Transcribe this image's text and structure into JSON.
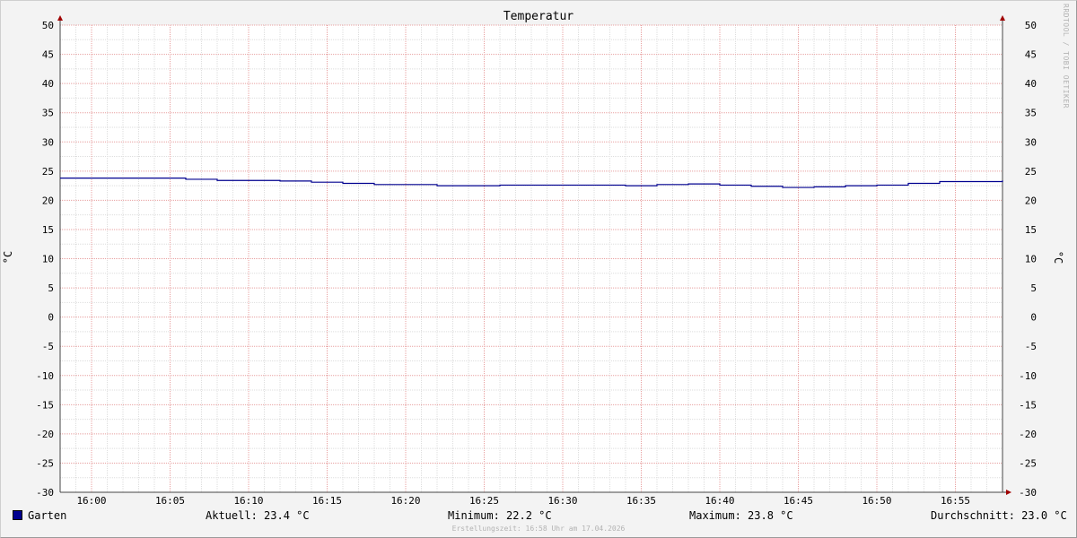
{
  "chart_data": {
    "type": "line",
    "title": "Temperatur",
    "ylabel": "°C",
    "ylim": [
      -30,
      50
    ],
    "yticks": [
      50,
      45,
      40,
      35,
      30,
      25,
      20,
      15,
      10,
      5,
      0,
      -5,
      -10,
      -15,
      -20,
      -25,
      -30
    ],
    "xtick_labels": [
      "16:00",
      "16:05",
      "16:10",
      "16:15",
      "16:20",
      "16:25",
      "16:30",
      "16:35",
      "16:40",
      "16:45",
      "16:50",
      "16:55"
    ],
    "xlim": [
      "15:58",
      "16:58"
    ],
    "grid": true,
    "legend_position": "bottom-left",
    "series": [
      {
        "name": "Garten",
        "color": "#00008f",
        "x": [
          "15:58",
          "16:06",
          "16:08",
          "16:12",
          "16:14",
          "16:16",
          "16:18",
          "16:22",
          "16:26",
          "16:30",
          "16:34",
          "16:36",
          "16:38",
          "16:40",
          "16:42",
          "16:44",
          "16:46",
          "16:48",
          "16:50",
          "16:52",
          "16:54",
          "16:56",
          "16:58"
        ],
        "y": [
          23.8,
          23.6,
          23.4,
          23.3,
          23.1,
          22.9,
          22.7,
          22.5,
          22.6,
          22.6,
          22.5,
          22.7,
          22.8,
          22.6,
          22.4,
          22.2,
          22.3,
          22.5,
          22.6,
          22.9,
          23.2,
          23.2,
          23.4
        ]
      }
    ]
  },
  "legend": {
    "series_name": "Garten",
    "current": "Aktuell: 23.4 °C",
    "minimum": "Minimum: 22.2 °C",
    "maximum": "Maximum: 23.8 °C",
    "average": "Durchschnitt: 23.0 °C"
  },
  "watermark": "RRDTOOL / TOBI OETIKER",
  "footer": "Erstellungszeit: 16:58 Uhr am 17.04.2026"
}
